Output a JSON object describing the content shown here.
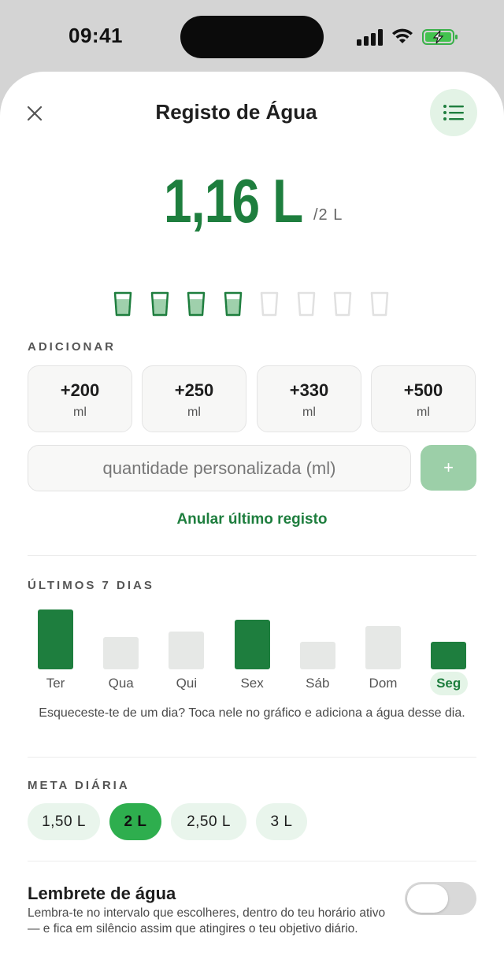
{
  "status_bar": {
    "time": "09:41"
  },
  "header": {
    "title": "Registo de Água"
  },
  "summary": {
    "amount": "1,16 L",
    "goal": "/2 L",
    "glasses_filled": 4,
    "glasses_total": 8
  },
  "add_section": {
    "label": "ADICIONAR",
    "buttons": [
      {
        "value": "+200",
        "unit": "ml"
      },
      {
        "value": "+250",
        "unit": "ml"
      },
      {
        "value": "+330",
        "unit": "ml"
      },
      {
        "value": "+500",
        "unit": "ml"
      }
    ],
    "custom_placeholder": "quantidade personalizada (ml)",
    "custom_add": "+",
    "undo": "Anular último registo"
  },
  "history": {
    "label": "ÚLTIMOS 7 DIAS",
    "hint": "Esqueceste-te de um dia? Toca nele no gráfico e adiciona a água desse dia.",
    "days": [
      {
        "label": "Ter",
        "fraction": 1.0,
        "met": true
      },
      {
        "label": "Qua",
        "fraction": 0.54,
        "met": false
      },
      {
        "label": "Qui",
        "fraction": 0.63,
        "met": false
      },
      {
        "label": "Sex",
        "fraction": 0.83,
        "met": true
      },
      {
        "label": "Sáb",
        "fraction": 0.46,
        "met": false
      },
      {
        "label": "Dom",
        "fraction": 0.73,
        "met": false
      },
      {
        "label": "Seg",
        "fraction": 0.46,
        "met": true,
        "today": true
      }
    ]
  },
  "daily_goal": {
    "label": "META DIÁRIA",
    "options": [
      "1,50 L",
      "2 L",
      "2,50 L",
      "3 L"
    ],
    "selected": "2 L"
  },
  "reminder": {
    "title": "Lembrete de água",
    "description": "Lembra-te no intervalo que escolheres, dentro do teu horário ativo — e fica em silêncio assim que atingires o teu objetivo diário.",
    "enabled": false
  },
  "colors": {
    "accent": "#1e7e3e",
    "chip_active": "#2eae4e",
    "bar_inactive": "#e6e8e6"
  }
}
